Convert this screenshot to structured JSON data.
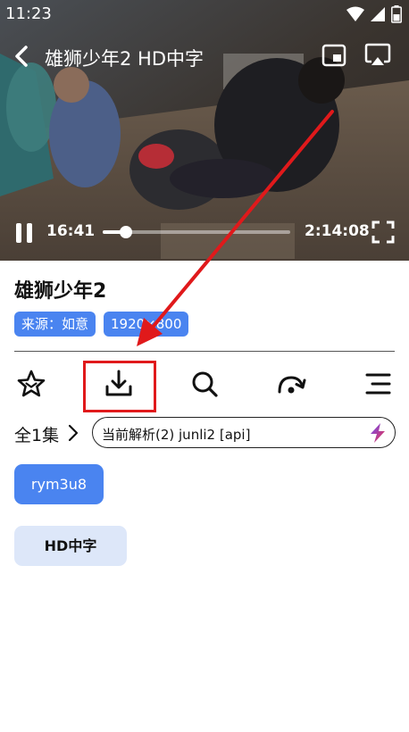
{
  "status_bar": {
    "time": "11:23"
  },
  "video": {
    "title": "雄狮少年2 HD中字",
    "current_time": "16:41",
    "total_time": "2:14:08",
    "progress": 0.124
  },
  "info": {
    "title": "雄狮少年2",
    "tags": [
      "来源：如意",
      "1920×800"
    ]
  },
  "actions": [
    "star-icon",
    "download-icon",
    "search-icon",
    "refresh-icon",
    "menu-icon"
  ],
  "episodes": {
    "count_label": "全1集",
    "parser": "当前解析(2)  junli2 [api]",
    "items": [
      "rym3u8",
      "HD中字"
    ]
  },
  "colors": {
    "accent": "#4a84f0",
    "highlight": "#e0191b",
    "secondary": "#dde7f9"
  }
}
